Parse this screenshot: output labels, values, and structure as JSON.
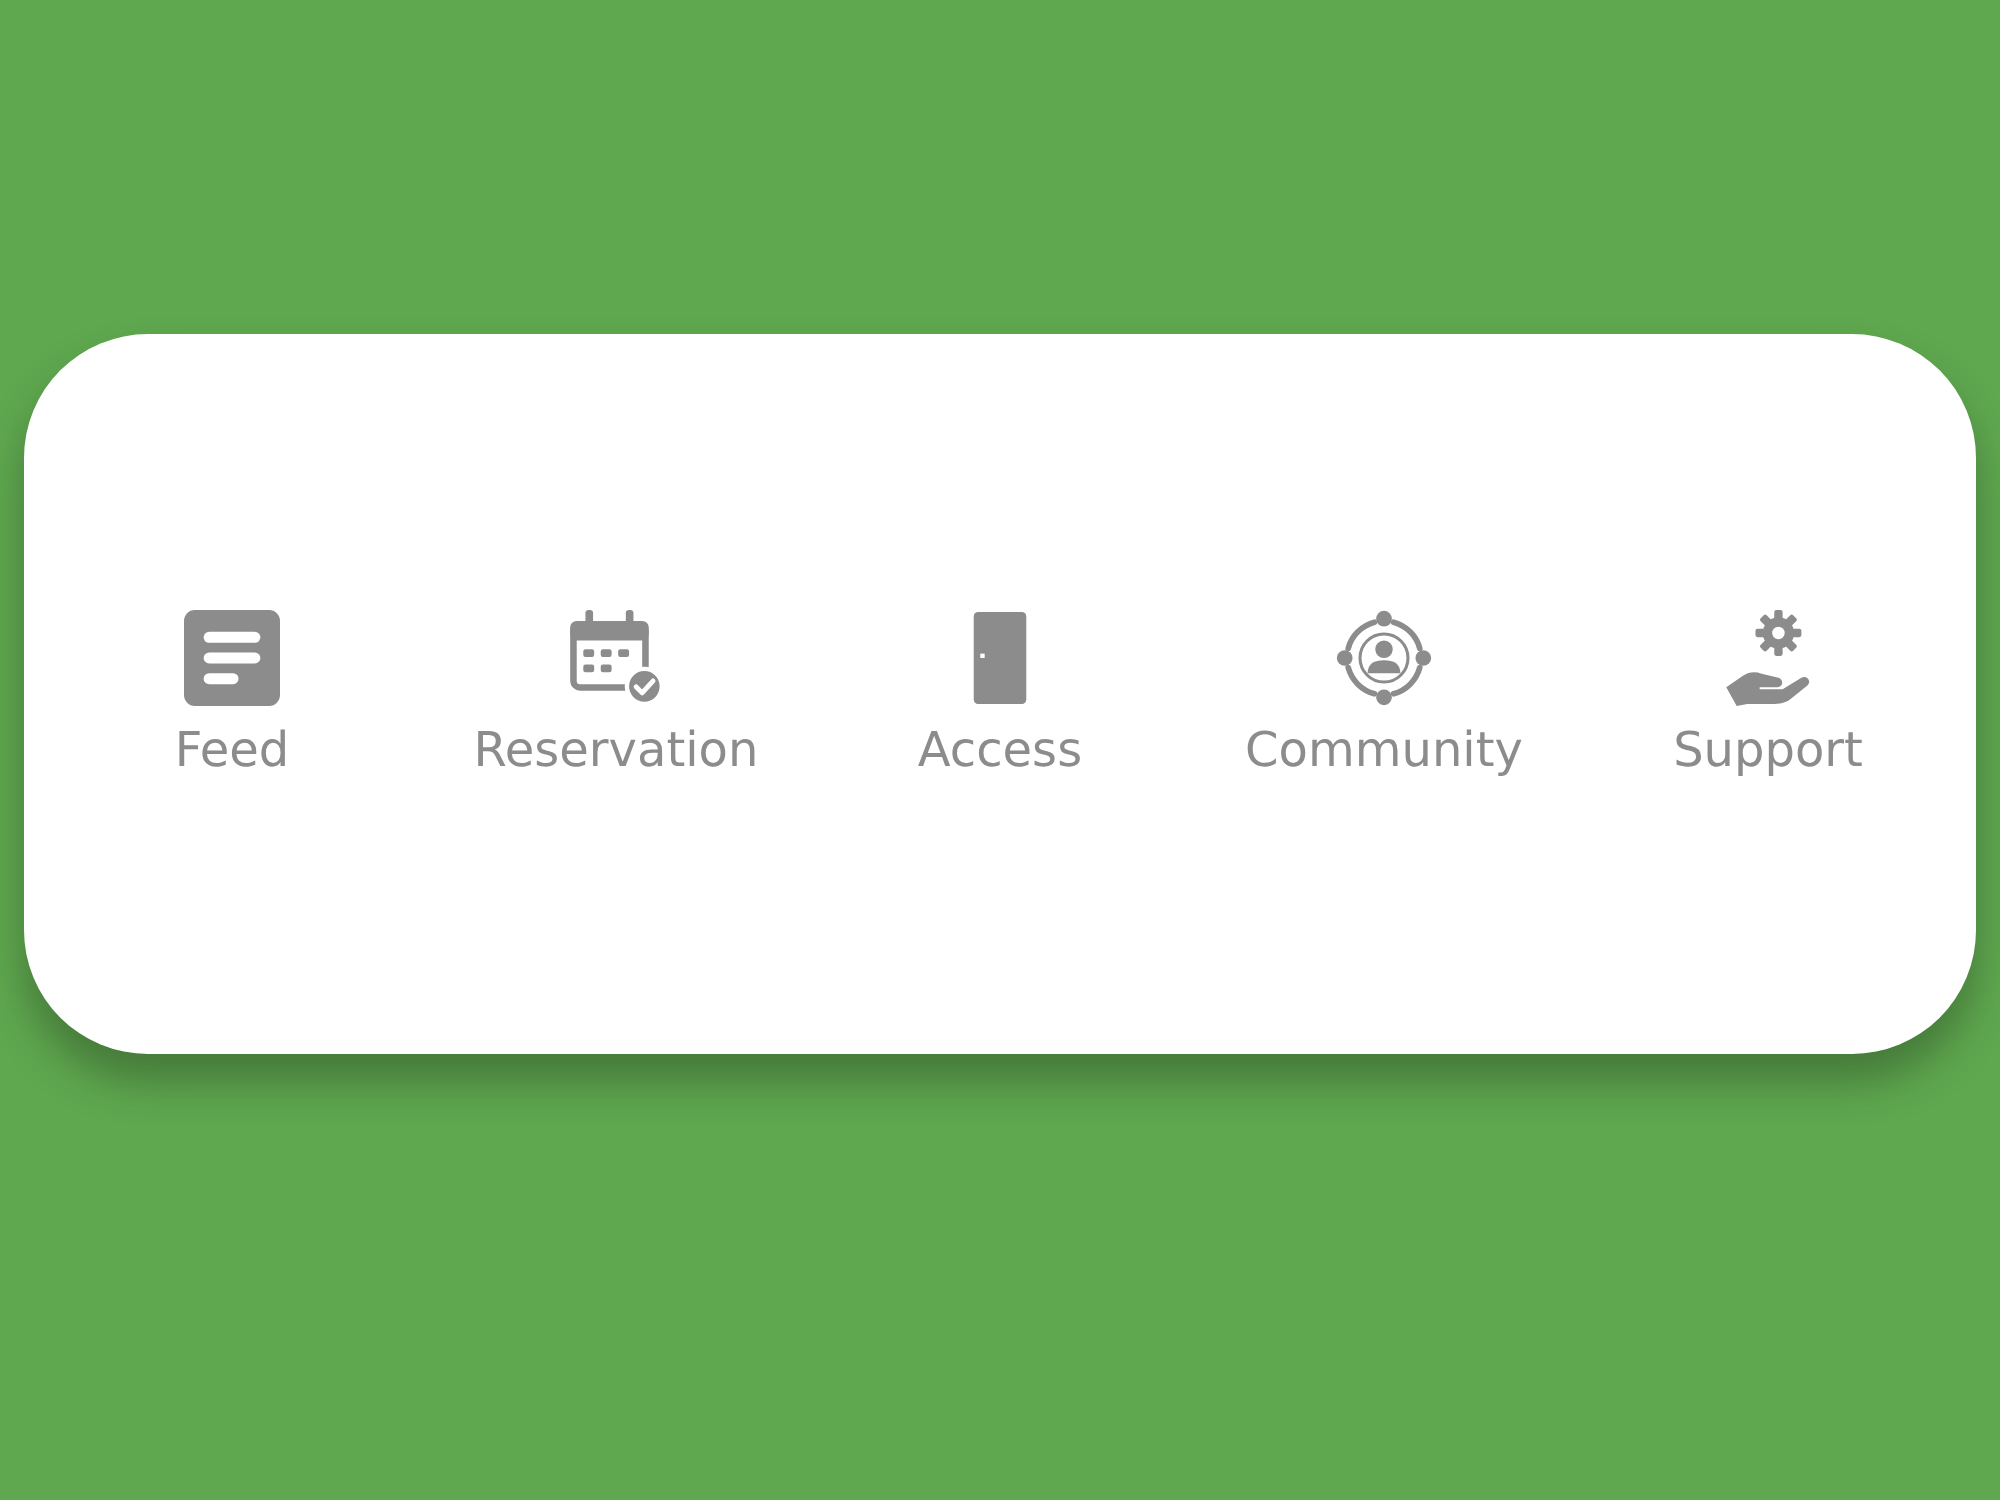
{
  "tab_bar": {
    "tabs": [
      {
        "label": "Feed",
        "selected": false
      },
      {
        "label": "Reservation",
        "selected": false
      },
      {
        "label": "Access",
        "selected": false
      },
      {
        "label": "Community",
        "selected": false
      },
      {
        "label": "Support",
        "selected": false
      }
    ]
  }
}
